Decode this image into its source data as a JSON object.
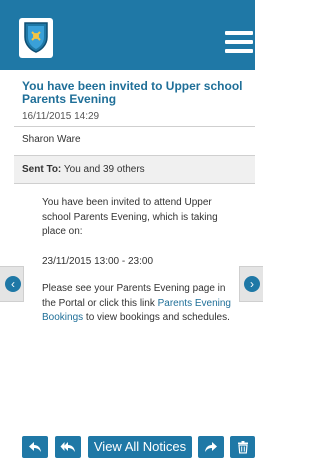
{
  "header": {
    "logo_icon": "school-crest-icon",
    "menu_icon": "hamburger-menu-icon",
    "brand_color": "#1f78a6"
  },
  "notice": {
    "title": "You have been invited to Upper school Parents Evening",
    "timestamp": "16/11/2015 14:29",
    "sender": "Sharon Ware",
    "sent_to_label": "Sent To:",
    "sent_to_value": "You and 39 others",
    "body": {
      "paragraph1": "You have been invited to attend Upper school Parents Evening, which is taking place on:",
      "date_line": "23/11/2015 13:00 - 23:00",
      "paragraph2_before": "Please see your Parents Evening page in the Portal or click this link ",
      "link_text": "Parents Evening Bookings",
      "paragraph2_after": " to view bookings and schedules."
    }
  },
  "navigation": {
    "prev_icon": "chevron-left-icon",
    "next_icon": "chevron-right-icon"
  },
  "toolbar": {
    "reply_icon": "reply-icon",
    "reply_all_icon": "reply-all-icon",
    "view_all_label": "View All Notices",
    "forward_icon": "forward-icon",
    "delete_icon": "trash-icon"
  }
}
